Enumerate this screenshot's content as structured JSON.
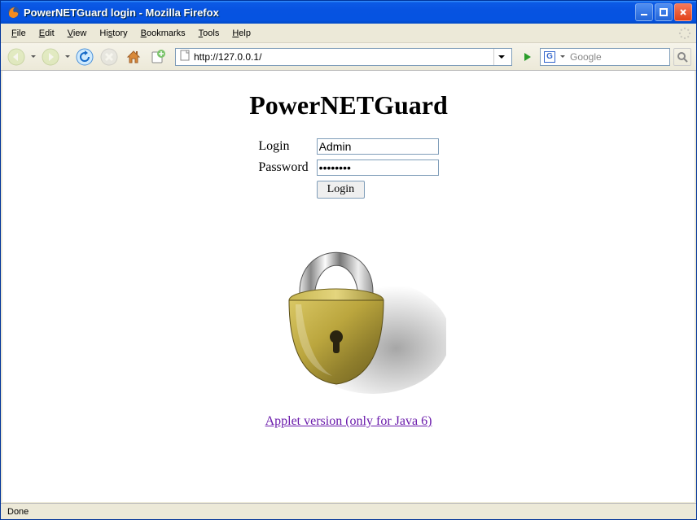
{
  "window": {
    "title": "PowerNETGuard login - Mozilla Firefox"
  },
  "menu": {
    "file": "File",
    "edit": "Edit",
    "view": "View",
    "history": "History",
    "bookmarks": "Bookmarks",
    "tools": "Tools",
    "help": "Help"
  },
  "toolbar": {
    "url": "http://127.0.0.1/",
    "search_placeholder": "Google"
  },
  "page": {
    "heading": "PowerNETGuard",
    "login_label": "Login",
    "password_label": "Password",
    "login_value": "Admin",
    "password_value": "********",
    "login_button": "Login",
    "applet_link": "Applet version (only for Java 6)"
  },
  "status": {
    "text": "Done"
  }
}
